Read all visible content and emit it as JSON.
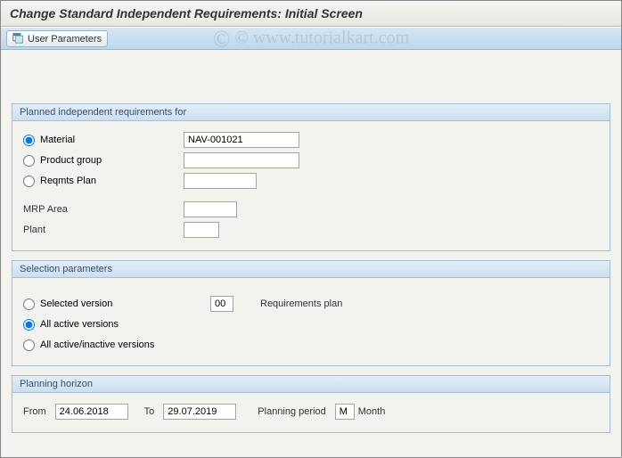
{
  "title": "Change Standard Independent Requirements: Initial Screen",
  "toolbar": {
    "user_params_label": "User Parameters"
  },
  "watermark": "© www.tutorialkart.com",
  "group_pir": {
    "title": "Planned independent requirements for",
    "radios": {
      "material_label": "Material",
      "product_group_label": "Product group",
      "reqmts_plan_label": "Reqmts Plan"
    },
    "material_value": "NAV-001021",
    "product_group_value": "",
    "reqmts_plan_value": "",
    "mrp_area_label": "MRP Area",
    "mrp_area_value": "",
    "plant_label": "Plant",
    "plant_value": ""
  },
  "group_sel": {
    "title": "Selection parameters",
    "selected_version_label": "Selected version",
    "selected_version_value": "00",
    "requirements_plan_label": "Requirements plan",
    "all_active_label": "All active versions",
    "all_inactive_label": "All active/inactive versions"
  },
  "group_horizon": {
    "title": "Planning horizon",
    "from_label": "From",
    "from_value": "24.06.2018",
    "to_label": "To",
    "to_value": "29.07.2019",
    "period_label": "Planning period",
    "period_code": "M",
    "period_text": "Month"
  }
}
